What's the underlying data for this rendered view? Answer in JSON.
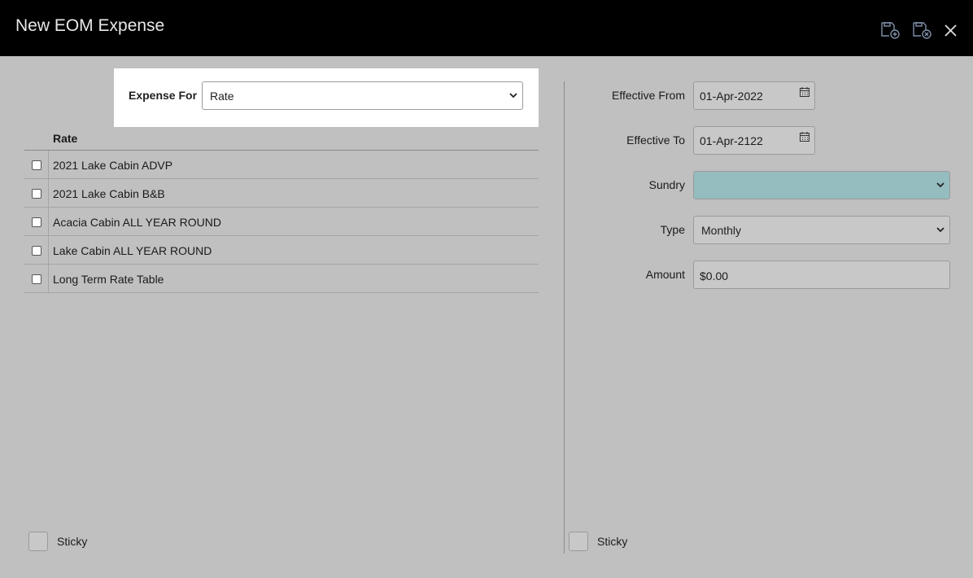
{
  "window": {
    "title": "New EOM Expense"
  },
  "toolbar": {
    "save_new_icon": "save-and-new-icon",
    "save_close_icon": "save-and-close-icon",
    "close_icon": "close-icon"
  },
  "expense_for": {
    "label": "Expense For",
    "value": "Rate"
  },
  "rates": {
    "header": "Rate",
    "items": [
      {
        "name": "2021 Lake Cabin ADVP",
        "checked": false
      },
      {
        "name": "2021 Lake Cabin B&B",
        "checked": false
      },
      {
        "name": "Acacia Cabin ALL YEAR ROUND",
        "checked": false
      },
      {
        "name": "Lake Cabin ALL YEAR ROUND",
        "checked": false
      },
      {
        "name": "Long Term Rate Table",
        "checked": false
      }
    ]
  },
  "form": {
    "effective_from": {
      "label": "Effective From",
      "value": "01-Apr-2022"
    },
    "effective_to": {
      "label": "Effective To",
      "value": "01-Apr-2122"
    },
    "sundry": {
      "label": "Sundry",
      "value": "",
      "color": "#95bcbf"
    },
    "type": {
      "label": "Type",
      "value": "Monthly"
    },
    "amount": {
      "label": "Amount",
      "value": "$0.00"
    }
  },
  "sticky": {
    "left_label": "Sticky",
    "right_label": "Sticky"
  }
}
